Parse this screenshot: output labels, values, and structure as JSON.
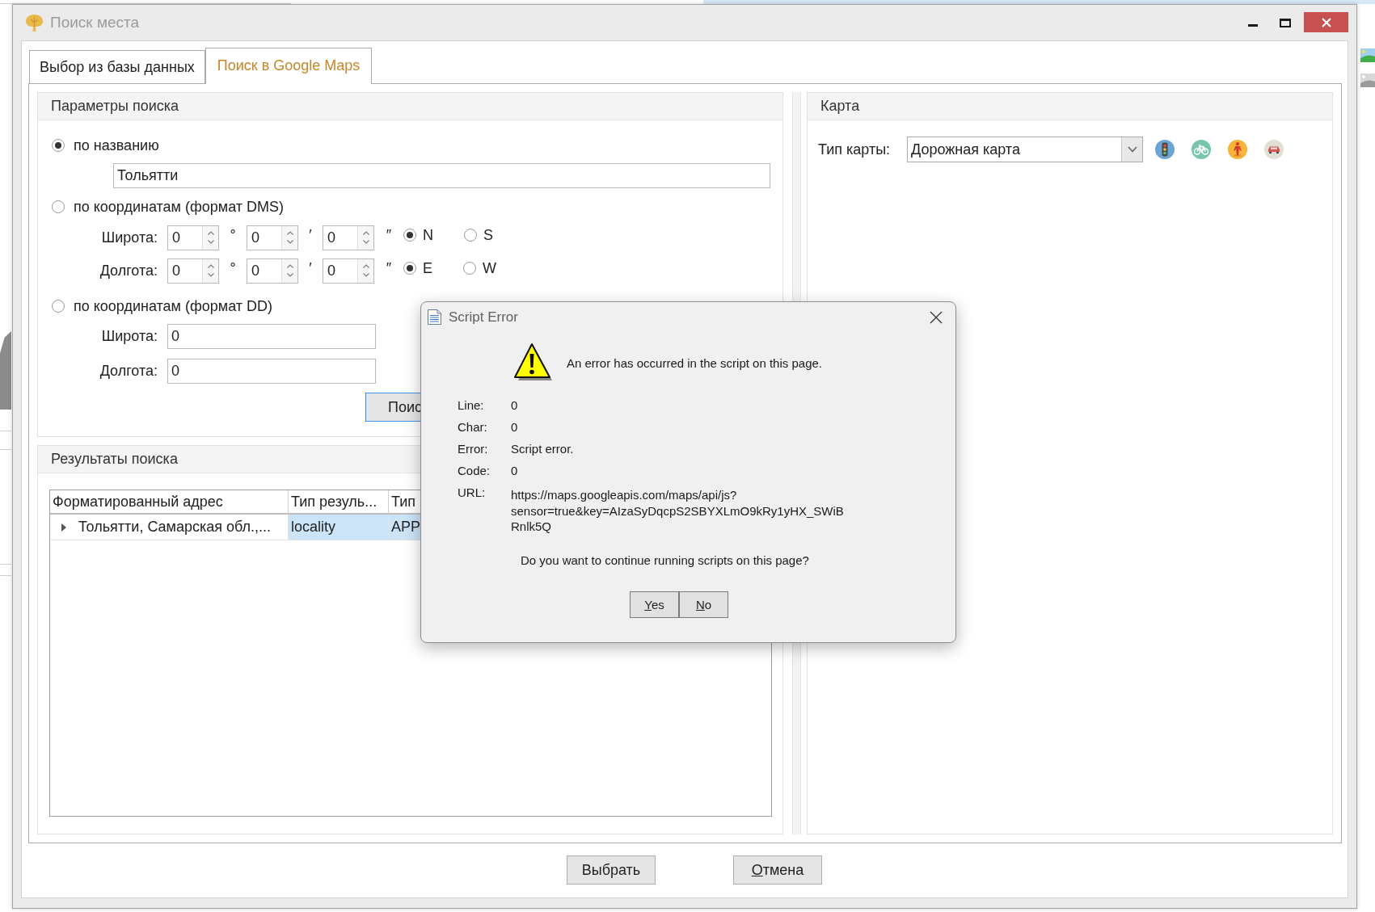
{
  "window": {
    "title": "Поиск места"
  },
  "tabs": [
    {
      "label": "Выбор из базы данных",
      "selected": false
    },
    {
      "label": "Поиск в Google Maps",
      "selected": true
    }
  ],
  "search_params": {
    "title": "Параметры поиска",
    "modes": [
      {
        "label": "по названию",
        "selected": true
      },
      {
        "label": "по координатам (формат DMS)",
        "selected": false
      },
      {
        "label": "по координатам (формат DD)",
        "selected": false
      }
    ],
    "name_field": {
      "value": "Тольятти"
    },
    "dms": [
      {
        "label": "Широта:",
        "degrees": "0",
        "degree_sign": "°",
        "minutes": "0",
        "minute_sign": "′",
        "seconds": "0",
        "second_sign": "″",
        "hemispheres": [
          {
            "label": "N",
            "selected": true
          },
          {
            "label": "S",
            "selected": false
          }
        ]
      },
      {
        "label": "Долгота:",
        "degrees": "0",
        "degree_sign": "°",
        "minutes": "0",
        "minute_sign": "′",
        "seconds": "0",
        "second_sign": "″",
        "hemispheres": [
          {
            "label": "E",
            "selected": true
          },
          {
            "label": "W",
            "selected": false
          }
        ]
      }
    ],
    "dd": [
      {
        "label": "Широта:",
        "value": "0"
      },
      {
        "label": "Долгота:",
        "value": "0"
      }
    ],
    "search_button": {
      "label": "Поис",
      "focused": true
    }
  },
  "results": {
    "title": "Результаты поиска",
    "columns": [
      "Форматированный адрес",
      "Тип резуль...",
      "Тип"
    ],
    "rows": [
      {
        "expanded": false,
        "cells": [
          {
            "text": "Тольятти, Самарская обл.,...",
            "selected": false
          },
          {
            "text": "locality",
            "selected": true
          },
          {
            "text": "APP",
            "selected": true
          }
        ]
      }
    ]
  },
  "map": {
    "title": "Карта",
    "map_type_label": "Тип карты:",
    "map_type": "Дорожная карта"
  },
  "buttons": [
    {
      "label": "Выбрать",
      "mnemonic": false
    },
    {
      "label": "Отмена",
      "mnemonic": true
    }
  ],
  "dialog": {
    "title": "Script Error",
    "message": "An error has occurred in the script on this page.",
    "details": [
      {
        "label": "Line:",
        "value": "0"
      },
      {
        "label": "Char:",
        "value": "0"
      },
      {
        "label": "Error:",
        "value": "Script error."
      },
      {
        "label": "Code:",
        "value": "0"
      }
    ],
    "url": {
      "label": "URL:",
      "lines": [
        "https://maps.googleapis.com/maps/api/js?",
        "sensor=true&key=AIzaSyDqcpS2SBYXLmO9kRy1yHX_SWiB",
        "Rnlk5Q"
      ]
    },
    "question": "Do you want to continue running scripts on this page?",
    "buttons": [
      {
        "label": "Yes",
        "mnemonic": true
      },
      {
        "label": "No",
        "mnemonic": true
      }
    ]
  }
}
